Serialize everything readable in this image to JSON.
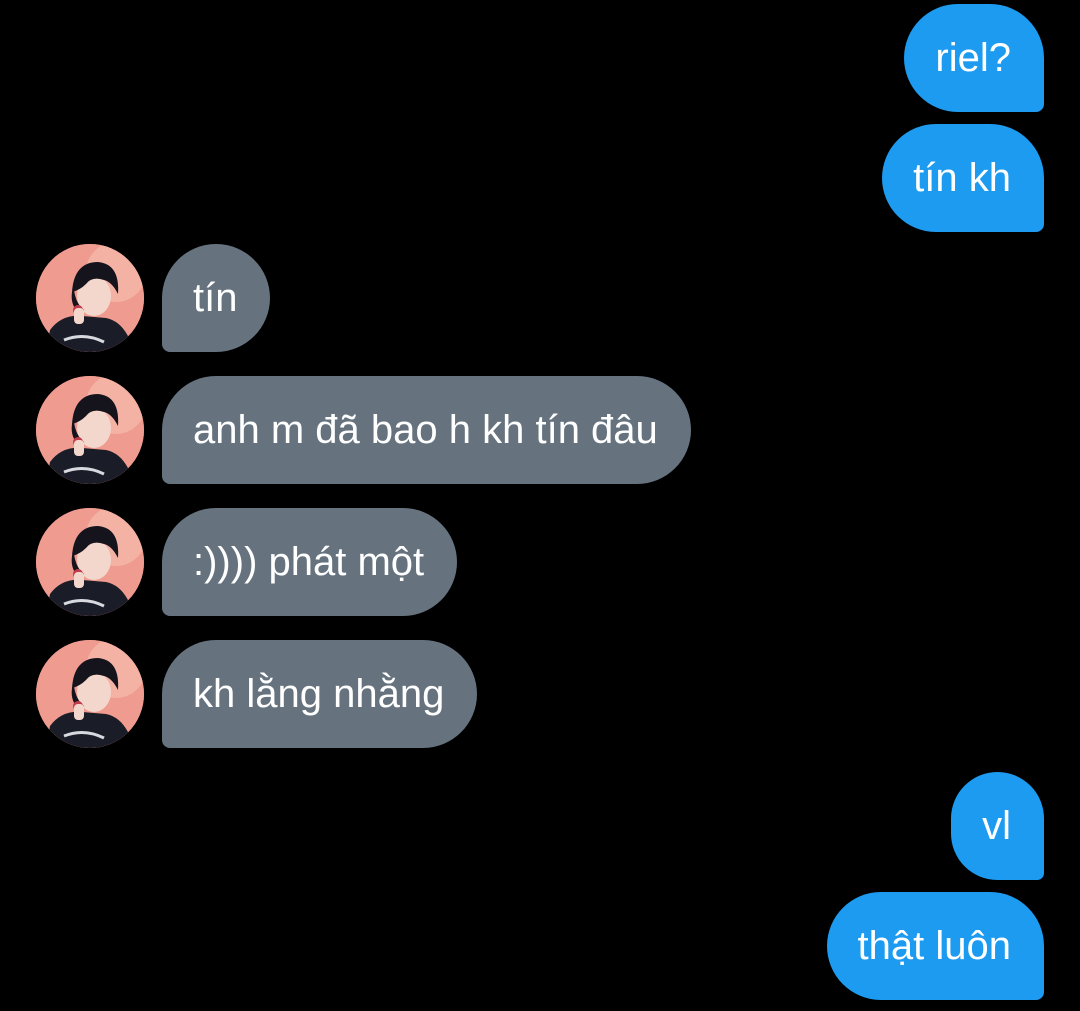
{
  "colors": {
    "background": "#000000",
    "sent_bubble": "#1d9bf0",
    "received_bubble": "#66737f",
    "text": "#ffffff"
  },
  "messages": [
    {
      "direction": "sent",
      "text": "riel?"
    },
    {
      "direction": "sent",
      "text": "tín kh"
    },
    {
      "direction": "received",
      "text": "tín",
      "avatar": "contact-avatar"
    },
    {
      "direction": "received",
      "text": "anh m đã bao h kh tín đâu",
      "avatar": "contact-avatar"
    },
    {
      "direction": "received",
      "text": ":)))) phát một",
      "avatar": "contact-avatar"
    },
    {
      "direction": "received",
      "text": "kh lằng nhằng",
      "avatar": "contact-avatar"
    },
    {
      "direction": "sent",
      "text": "vl"
    },
    {
      "direction": "sent",
      "text": "thật luôn"
    }
  ]
}
